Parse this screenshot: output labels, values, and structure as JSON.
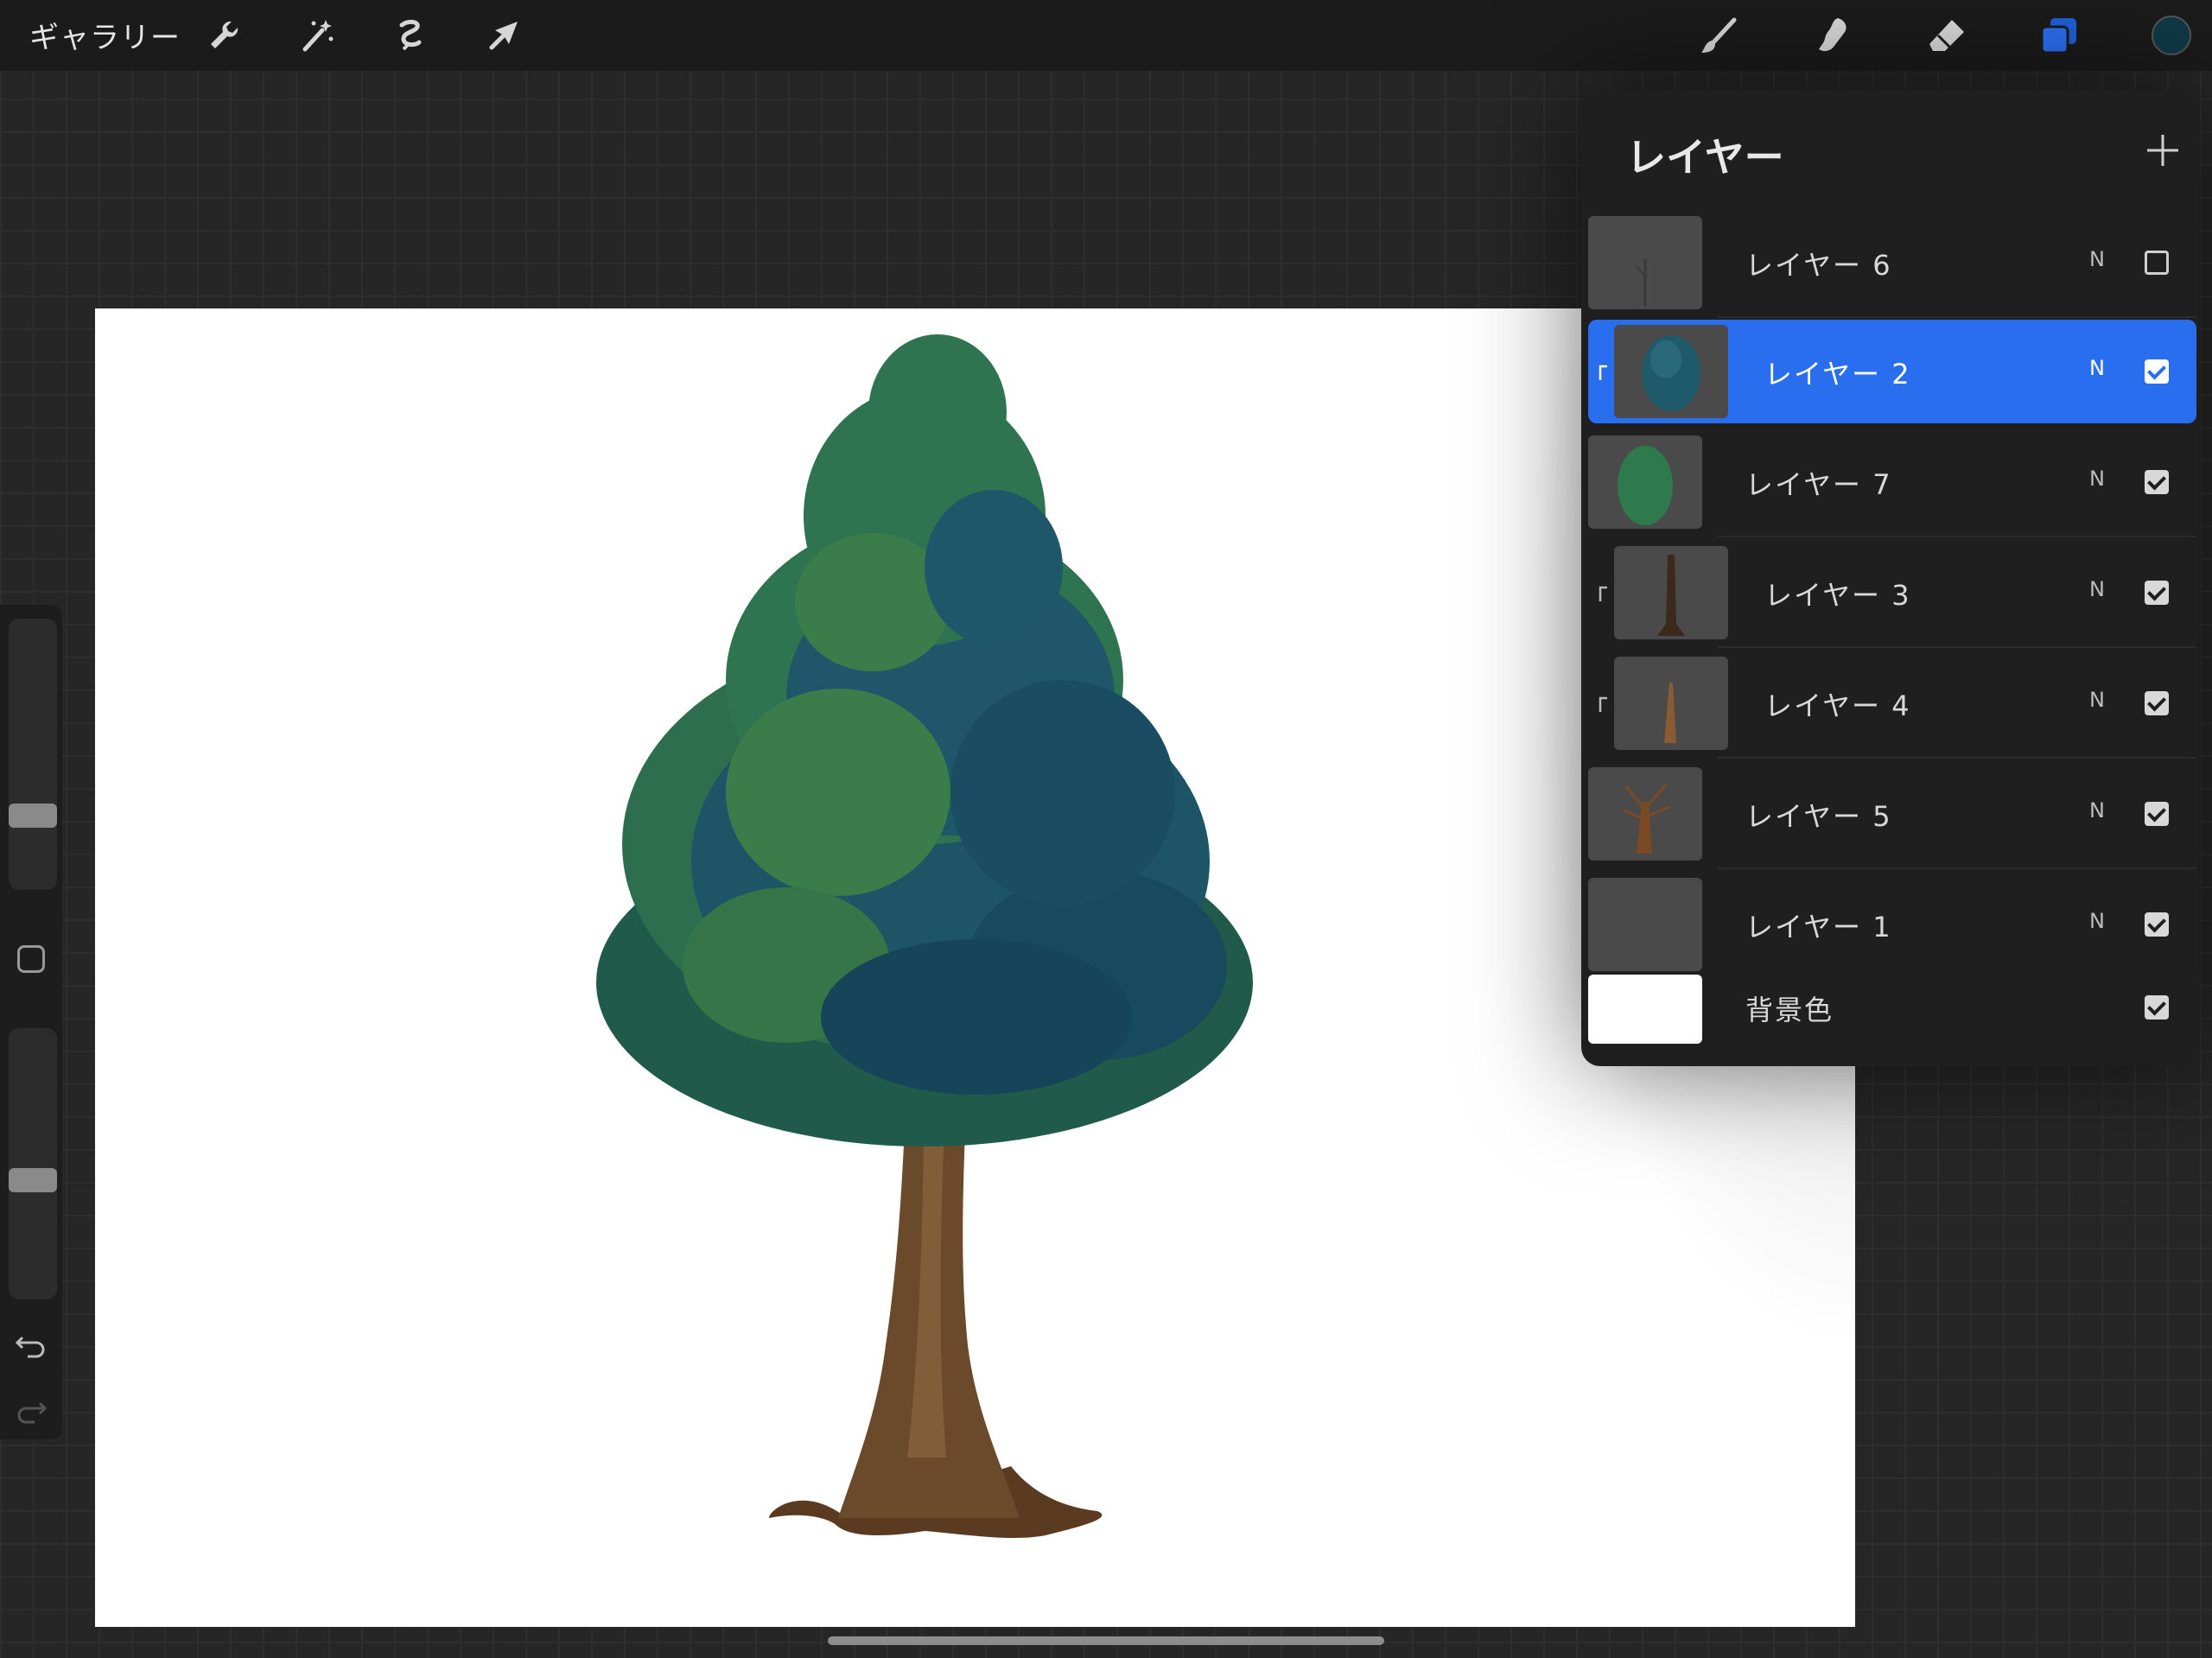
{
  "toolbar": {
    "gallery_label": "ギャラリー",
    "left_icons": [
      "wrench-icon",
      "magic-wand-icon",
      "selection-icon",
      "transform-arrow-icon"
    ],
    "right_icons": [
      "brush-icon",
      "smudge-icon",
      "eraser-icon",
      "layers-icon",
      "color-swatch-icon"
    ],
    "active_tool": "layers",
    "accent_color": "#2a6ef0",
    "current_color": "#0f3a47"
  },
  "sidebar": {
    "brush_size_level": 0.73,
    "opacity_level": 0.58,
    "icons": [
      "modifier-square-icon",
      "undo-icon",
      "redo-icon"
    ]
  },
  "layers_panel": {
    "title": "レイヤー",
    "add_icon": "plus-icon",
    "layers": [
      {
        "name": "レイヤー 6",
        "blend": "N",
        "visible": false,
        "selected": false,
        "clipped": false
      },
      {
        "name": "レイヤー 2",
        "blend": "N",
        "visible": true,
        "selected": true,
        "clipped": true
      },
      {
        "name": "レイヤー 7",
        "blend": "N",
        "visible": true,
        "selected": false,
        "clipped": false
      },
      {
        "name": "レイヤー 3",
        "blend": "N",
        "visible": true,
        "selected": false,
        "clipped": true
      },
      {
        "name": "レイヤー 4",
        "blend": "N",
        "visible": true,
        "selected": false,
        "clipped": true
      },
      {
        "name": "レイヤー 5",
        "blend": "N",
        "visible": true,
        "selected": false,
        "clipped": false
      },
      {
        "name": "レイヤー 1",
        "blend": "N",
        "visible": true,
        "selected": false,
        "clipped": false
      }
    ],
    "background": {
      "name": "背景色",
      "visible": true,
      "color": "#ffffff"
    }
  },
  "canvas": {
    "background_color": "#ffffff",
    "subject": "tree-illustration"
  }
}
